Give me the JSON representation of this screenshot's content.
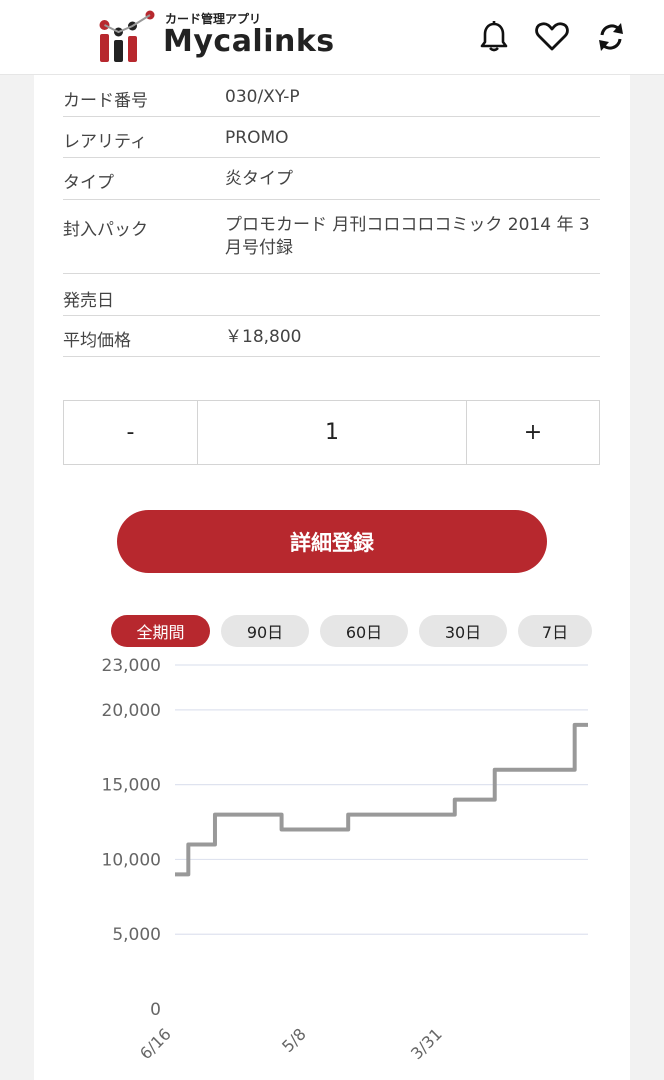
{
  "header": {
    "logo_sub": "カード管理アプリ",
    "logo_main": "Mycalinks",
    "icons": [
      "bell-icon",
      "heart-icon",
      "refresh-icon"
    ],
    "brand_color": "#b7282e"
  },
  "details": [
    {
      "label": "カード番号",
      "value": "030/XY-P"
    },
    {
      "label": "レアリティ",
      "value": "PROMO"
    },
    {
      "label": "タイプ",
      "value": "炎タイプ"
    },
    {
      "label": "封入パック",
      "value": "プロモカード 月刊コロコロコミック 2014 年 3 月号付録"
    },
    {
      "label": "発売日",
      "value": ""
    },
    {
      "label": "平均価格",
      "value": "￥18,800"
    }
  ],
  "stepper": {
    "minus": "-",
    "value": "1",
    "plus": "+"
  },
  "register_button": "詳細登録",
  "range_tabs": [
    {
      "label": "全期間",
      "active": true
    },
    {
      "label": "90日",
      "active": false
    },
    {
      "label": "60日",
      "active": false
    },
    {
      "label": "30日",
      "active": false
    },
    {
      "label": "7日",
      "active": false
    }
  ],
  "chart_data": {
    "type": "line",
    "title": "",
    "xlabel": "",
    "ylabel": "",
    "ylim": [
      0,
      23000
    ],
    "y_ticks": [
      "23,000",
      "20,000",
      "15,000",
      "10,000",
      "5,000",
      "0"
    ],
    "x_ticks": [
      "6/16",
      "5/8",
      "3/31"
    ],
    "grid": true,
    "series": [
      {
        "values": [
          9000,
          11000,
          11000,
          13000,
          13000,
          13000,
          13000,
          13000,
          12000,
          12000,
          12000,
          12000,
          12000,
          13000,
          13000,
          13000,
          13000,
          13000,
          13000,
          13000,
          13000,
          14000,
          14000,
          14000,
          16000,
          16000,
          16000,
          16000,
          16000,
          16000,
          19000,
          19000
        ],
        "color": "#999999"
      }
    ]
  }
}
